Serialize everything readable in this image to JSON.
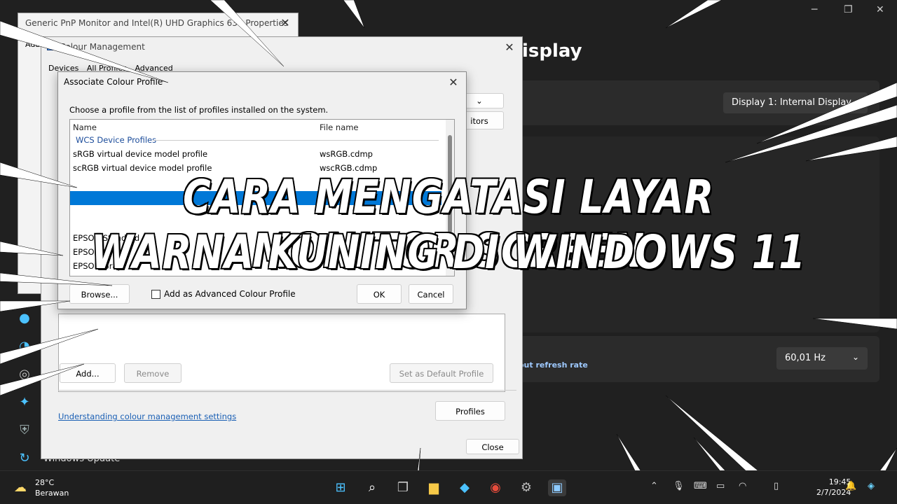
{
  "headline": {
    "line1": "CARA MENGATASI LAYAR MONITOR SCREEN",
    "line2": "WARNA KUNING DI WINDOWS 11"
  },
  "settings": {
    "title_partial": "isplay",
    "display_select": "Display 1: Internal Display",
    "refresh_link_partial": "out refresh rate",
    "refresh_value": "60,01 Hz",
    "monitors_partial": "itors",
    "windows_update": "Windows Update"
  },
  "props_window": {
    "title": "Generic PnP Monitor and Intel(R) UHD Graphics 630 Properties",
    "tab_partial": "Ada"
  },
  "colour_mgmt": {
    "title": "Colour Management",
    "tabs": [
      "Devices",
      "All Profiles",
      "Advanced"
    ],
    "add_label": "Add...",
    "remove_label": "Remove",
    "set_default_label": "Set as Default Profile",
    "link": "Understanding colour management settings",
    "profiles_label": "Profiles",
    "close_label": "Close"
  },
  "assoc_dialog": {
    "title": "Associate Colour Profile",
    "instruction": "Choose a profile from the list of profiles installed on the system.",
    "col_name": "Name",
    "col_file": "File name",
    "group": "WCS Device Profiles",
    "rows": [
      {
        "name": "sRGB virtual device model profile",
        "file": "wsRGB.cdmp"
      },
      {
        "name": "scRGB virtual device model profile",
        "file": "wscRGB.cdmp"
      },
      {
        "name": "EPSON Standard",
        "file": ""
      },
      {
        "name": "EPSON Gray",
        "file": ""
      },
      {
        "name": "EPSON Gray",
        "file": ""
      }
    ],
    "browse_label": "Browse...",
    "checkbox_label": "Add as Advanced Colour Profile",
    "ok_label": "OK",
    "cancel_label": "Cancel"
  },
  "taskbar": {
    "temp": "28°C",
    "weather": "Berawan",
    "time": "19:45",
    "date": "2/7/2024"
  }
}
